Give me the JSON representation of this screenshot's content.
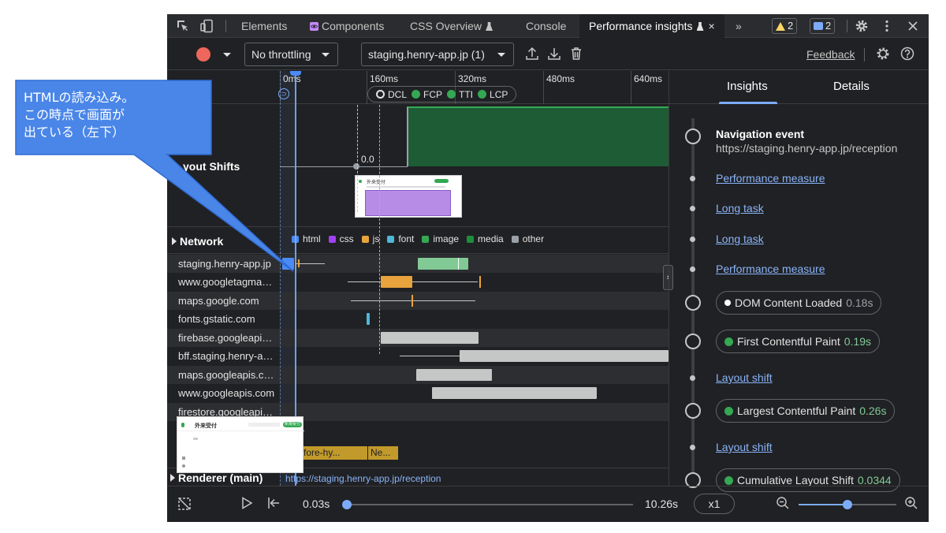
{
  "devtools": {
    "tabs": [
      {
        "label": "Elements"
      },
      {
        "label": "Components"
      },
      {
        "label": "CSS Overview"
      },
      {
        "label": "Console"
      },
      {
        "label": "Performance insights",
        "active": true
      }
    ],
    "more_tabs": "»",
    "close_glyph": "×",
    "warnings_count": "2",
    "messages_count": "2"
  },
  "toolbar": {
    "throttling": "No throttling",
    "page_select": "staging.henry-app.jp (1)",
    "feedback": "Feedback"
  },
  "ruler": {
    "ticks": [
      "0ms",
      "160ms",
      "320ms",
      "480ms",
      "640ms"
    ],
    "markers": [
      "DCL",
      "FCP",
      "TTI",
      "LCP"
    ]
  },
  "layout_shifts": {
    "label": "Layout Shifts",
    "visible_label": "yout Shifts",
    "value": "0.0"
  },
  "network": {
    "title": "Network",
    "legend": [
      {
        "label": "html",
        "color": "#4c8bf5"
      },
      {
        "label": "css",
        "color": "#a142f4"
      },
      {
        "label": "js",
        "color": "#e8a33d"
      },
      {
        "label": "font",
        "color": "#4fb8d8"
      },
      {
        "label": "image",
        "color": "#34a853"
      },
      {
        "label": "media",
        "color": "#34a853"
      },
      {
        "label": "other",
        "color": "#9aa0a6"
      }
    ],
    "rows": [
      {
        "host": "staging.henry-app.jp"
      },
      {
        "host": "www.googletagmanager.com"
      },
      {
        "host": "maps.google.com"
      },
      {
        "host": "fonts.gstatic.com"
      },
      {
        "host": "firebase.googleapis.com"
      },
      {
        "host": "bff.staging.henry-app.jp"
      },
      {
        "host": "maps.googleapis.com"
      },
      {
        "host": "www.googleapis.com"
      },
      {
        "host": "firestore.googleapis.com"
      }
    ]
  },
  "main_thread": {
    "tasks": [
      "fore-hy...",
      "Ne..."
    ]
  },
  "renderer": {
    "title": "Renderer (main)",
    "url": "https://staging.henry-app.jp/reception"
  },
  "screenshot_thumb": {
    "title": "外来受付",
    "button": "新規受付"
  },
  "insights": {
    "tabs": [
      "Insights",
      "Details"
    ],
    "nav_title": "Navigation event",
    "nav_url": "https://staging.henry-app.jp/reception",
    "items": [
      {
        "kind": "link",
        "label": "Performance measure"
      },
      {
        "kind": "link",
        "label": "Long task"
      },
      {
        "kind": "link",
        "label": "Long task"
      },
      {
        "kind": "link",
        "label": "Performance measure"
      },
      {
        "kind": "pill",
        "label": "DOM Content Loaded",
        "value": "0.18s"
      },
      {
        "kind": "pill",
        "label": "First Contentful Paint",
        "value": "0.19s"
      },
      {
        "kind": "link",
        "label": "Layout shift"
      },
      {
        "kind": "pill",
        "label": "Largest Contentful Paint",
        "value": "0.26s"
      },
      {
        "kind": "link",
        "label": "Layout shift"
      },
      {
        "kind": "pill",
        "label": "Cumulative Layout Shift",
        "value": "0.0344"
      }
    ]
  },
  "playback": {
    "current_time": "0.03s",
    "total_time": "10.26s",
    "speed": "x1",
    "position": 0.003,
    "zoom_level": 0.5
  },
  "annotation": {
    "text": "HTMLの読み込み。\nこの時点で画面が\n出ている（左下）"
  }
}
